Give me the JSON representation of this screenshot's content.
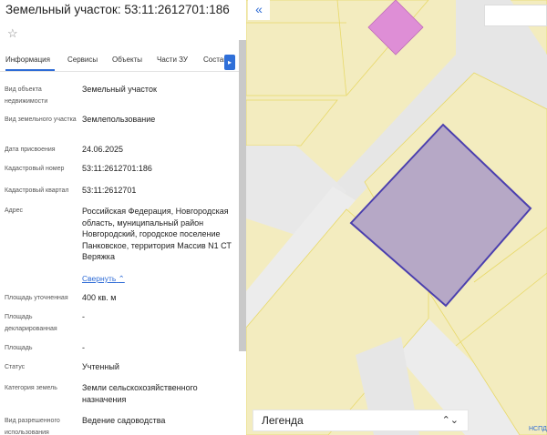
{
  "panel": {
    "title": "Земельный участок: 53:11:2612701:186",
    "star_glyph": "☆",
    "tabs": [
      "Информация",
      "Сервисы",
      "Объекты",
      "Части ЗУ",
      "Состав"
    ],
    "active_tab": "Информация",
    "tab_next_glyph": "▸",
    "fields": [
      {
        "label": "Вид объекта недвижимости",
        "value": "Земельный участок"
      },
      {
        "label": "Вид земельного участка",
        "value": "Землепользование"
      },
      {
        "label": "Дата присвоения",
        "value": "24.06.2025"
      },
      {
        "label": "Кадастровый номер",
        "value": "53:11:2612701:186"
      },
      {
        "label": "Кадастровый квартал",
        "value": "53:11:2612701"
      },
      {
        "label": "Адрес",
        "value": "Российская Федерация, Новгородская область, муниципальный район Новгородский, городское поселение Панковское, территория Массив N1 СТ Веряжка"
      },
      {
        "label": "Площадь уточненная",
        "value": "400 кв. м"
      },
      {
        "label": "Площадь декларированная",
        "value": "-"
      },
      {
        "label": "Площадь",
        "value": "-"
      },
      {
        "label": "Статус",
        "value": "Учтенный"
      },
      {
        "label": "Категория земель",
        "value": "Земли сельскохозяйственного назначения"
      },
      {
        "label": "Вид разрешенного использования",
        "value": "Ведение садоводства"
      }
    ],
    "collapse_label": "Свернуть",
    "collapse_glyph": "⌃"
  },
  "map": {
    "collapse_button_glyph": "«",
    "legend_label": "Легенда",
    "legend_chevron": "⌃⌄",
    "attribution": "НСПД",
    "colors": {
      "background": "#f3ecbf",
      "road": "#e6e6e6",
      "selected_parcel_fill": "#b6a8c6",
      "selected_parcel_stroke": "#4b3fae",
      "building_fill": "#de8ed6",
      "parcel_border": "#e8d96a"
    }
  }
}
